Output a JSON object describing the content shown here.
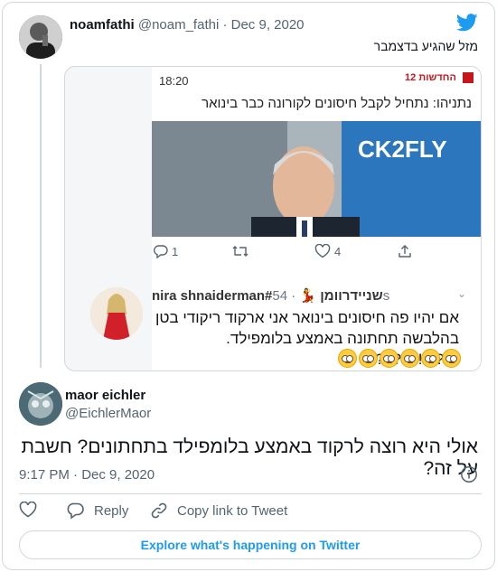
{
  "parent": {
    "name": "noamfathi",
    "handle": "@noam_fathi",
    "date": "· Dec 9, 2020",
    "text": "מזל שהגיע בדצמבר"
  },
  "embed": {
    "status_time": "18:20",
    "news_brand": "החדשות",
    "news_channel": "12",
    "headline": "נתניהו: נתחיל לקבל חיסונים לקורונה כבר בינואר",
    "photo_sign": "CK2FLY",
    "replies": "1",
    "likes": "4",
    "inner_tweet": {
      "name": "nira shnaiderman#שניידרוומן",
      "time": "· 54s",
      "text_line1": "אם יהיו פה חיסונים בינואר אני ארקוד ריקודי בטן",
      "text_line2": "בהלבשה תחתונה באמצע בלומפילד. יש?!?!?????",
      "emoji_count": 6
    }
  },
  "main": {
    "name": "maor eichler",
    "handle": "@EichlerMaor",
    "text": "אולי היא רוצה לרקוד באמצע בלומפילד בתחתונים? חשבת על זה?",
    "timestamp": "9:17 PM · Dec 9, 2020"
  },
  "actions": {
    "reply": "Reply",
    "copy_link": "Copy link to Tweet"
  },
  "explore": "Explore what's happening on Twitter",
  "colors": {
    "accent": "#1d9bf0",
    "text_secondary": "#536471",
    "border": "#cfd9de"
  }
}
